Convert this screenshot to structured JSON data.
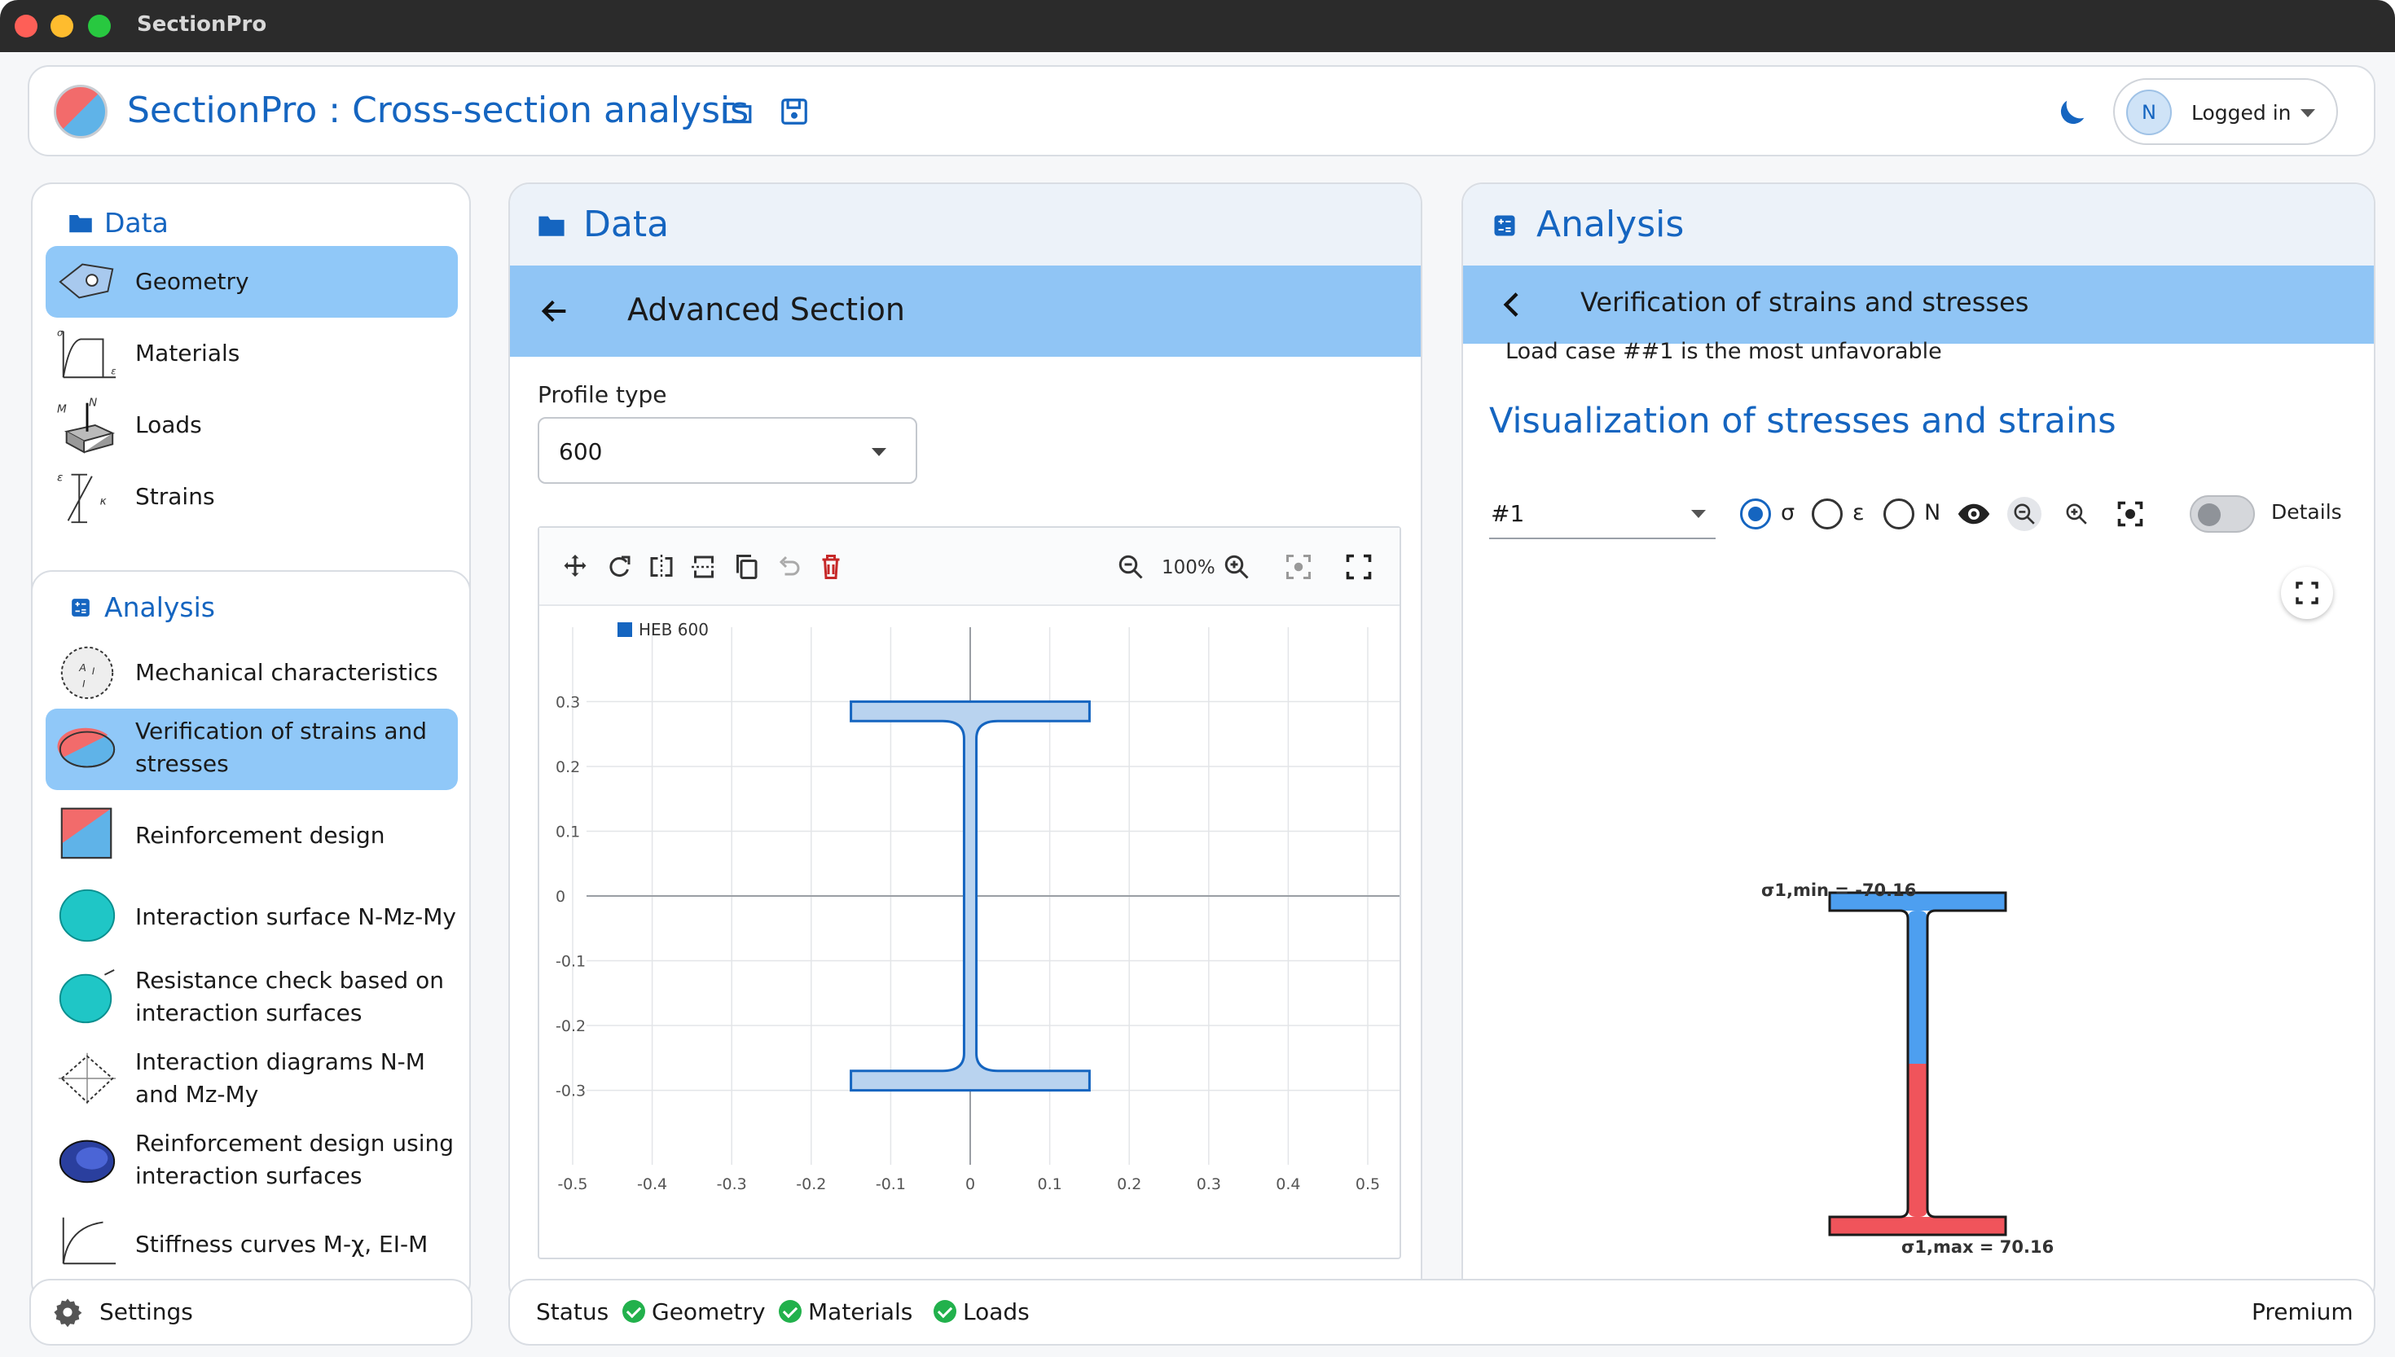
{
  "window": {
    "title": "SectionPro"
  },
  "header": {
    "app_title": "SectionPro : Cross-section analysis",
    "user_initial": "N",
    "user_label": "Logged in"
  },
  "sidebar": {
    "data_title": "Data",
    "data_items": [
      {
        "label": "Geometry",
        "active": true
      },
      {
        "label": "Materials",
        "active": false
      },
      {
        "label": "Loads",
        "active": false
      },
      {
        "label": "Strains",
        "active": false
      }
    ],
    "analysis_title": "Analysis",
    "analysis_items": [
      {
        "label": "Mechanical characteristics",
        "active": false
      },
      {
        "label": "Verification of strains and stresses",
        "active": true
      },
      {
        "label": "Reinforcement design",
        "active": false
      },
      {
        "label": "Interaction surface N-Mz-My",
        "active": false
      },
      {
        "label": "Resistance check based on interaction surfaces",
        "active": false
      },
      {
        "label": "Interaction diagrams N-M and Mz-My",
        "active": false
      },
      {
        "label": "Reinforcement design using interaction surfaces",
        "active": false
      },
      {
        "label": "Stiffness curves M-χ, EI-M",
        "active": false
      }
    ],
    "settings_label": "Settings"
  },
  "data_panel": {
    "title": "Data",
    "subtitle": "Advanced Section",
    "profile_type_label": "Profile type",
    "profile_type_value": "600",
    "zoom_level": "100%",
    "legend_label": "HEB 600"
  },
  "chart_data": {
    "type": "scatter",
    "series": [
      {
        "name": "HEB 600",
        "color": "#1565c0"
      }
    ],
    "x_ticks": [
      "-0.5",
      "-0.4",
      "-0.3",
      "-0.2",
      "-0.1",
      "0",
      "0.1",
      "0.2",
      "0.3",
      "0.4",
      "0.5"
    ],
    "y_ticks": [
      "0.3",
      "0.2",
      "0.1",
      "0",
      "-0.1",
      "-0.2",
      "-0.3"
    ],
    "xlim": [
      -0.5,
      0.5
    ],
    "ylim": [
      -0.3,
      0.3
    ],
    "section": {
      "h": 0.6,
      "b": 0.3,
      "tw": 0.0155,
      "tf": 0.03,
      "r": 0.027
    },
    "grid": true
  },
  "analysis_panel": {
    "title": "Analysis",
    "subtitle": "Verification of strains and stresses",
    "load_case_note": "Load case ##1 is the most unfavorable",
    "visualization_title": "Visualization of stresses and strains",
    "load_case_value": "#1",
    "radio_sigma": "σ",
    "radio_epsilon": "ε",
    "radio_n": "N",
    "details_label": "Details",
    "sigma_min_label": "σ1,min = -70.16",
    "sigma_max_label": "σ1,max = 70.16",
    "colors": {
      "compression": "#4d9ff0",
      "tension": "#f0545b"
    }
  },
  "status": {
    "label": "Status",
    "items": [
      "Geometry",
      "Materials",
      "Loads"
    ],
    "plan": "Premium"
  }
}
